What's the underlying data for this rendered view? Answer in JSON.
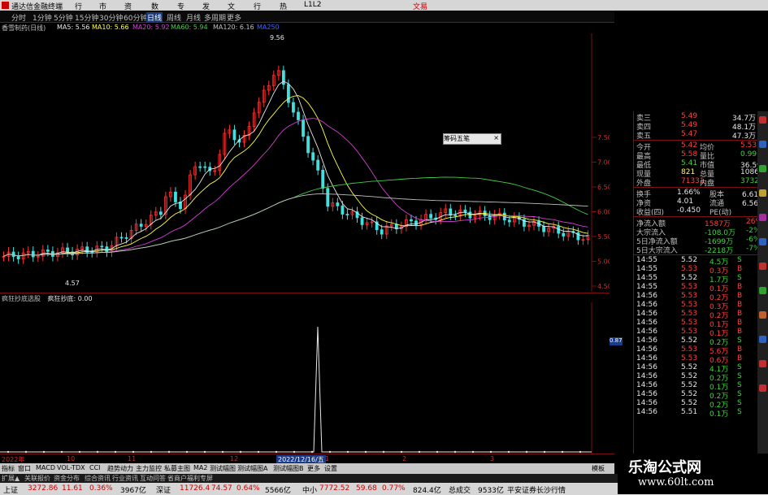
{
  "app": {
    "title": "通达信金融终端",
    "menu": [
      "行情",
      "市场",
      "资讯",
      "数据",
      "专题",
      "发现",
      "文题",
      "行业",
      "热点",
      "L1L2"
    ],
    "trade_label": "文易"
  },
  "toolbar": {
    "items": [
      "分时",
      "1分钟",
      "5分钟",
      "15分钟",
      "30分钟",
      "60分钟",
      "日线",
      "周线",
      "月线",
      "多周期",
      "更多"
    ],
    "active_index": 6
  },
  "legend": {
    "stock": "香雪制药(日线)",
    "ma": [
      {
        "label": "MA5: 5.56",
        "color": "#e8e8e8"
      },
      {
        "label": "MA10: 5.66",
        "color": "#ffff40"
      },
      {
        "label": "MA20: 5.92",
        "color": "#d040d0"
      },
      {
        "label": "MA60: 5.94",
        "color": "#40d040"
      },
      {
        "label": "MA120: 6.16",
        "color": "#c0c0c0"
      },
      {
        "label": "MA250",
        "color": "#4060ff"
      }
    ]
  },
  "main_chart": {
    "y_ticks": [
      "7.50",
      "7.00",
      "6.50",
      "6.00",
      "5.50",
      "5.00",
      "4.50"
    ],
    "high_label": "9.56",
    "low_label": "4.57"
  },
  "indicator": {
    "title": "疯狂抄底选股",
    "value_label": "疯狂抄底: 0.00",
    "y_tick": "0.87"
  },
  "x_axis": {
    "labels": [
      "2022年",
      "10",
      "11",
      "12",
      "1",
      "2",
      "3"
    ],
    "highlight": "2022/12/16/五"
  },
  "tabs": [
    "指标",
    "窗口",
    "MACD",
    "VOL-TDX",
    "CCI",
    "趋势动力",
    "主力监控",
    "私募主图",
    "MA2",
    "测试幅图",
    "测试幅图A",
    "测试幅图B",
    "更多",
    "设置"
  ],
  "tabs_right": "模板",
  "tabs2": [
    "扩展▲",
    "关联报价",
    "资金分布",
    "综合资讯",
    "行业资讯",
    "互动问答",
    "省商户福利专屏"
  ],
  "widget_label": "筹码五笔",
  "quote": {
    "asks": [
      {
        "label": "卖三",
        "price": "5.49",
        "vol": "34.7万"
      },
      {
        "label": "卖四",
        "price": "5.49",
        "vol": "48.1万"
      },
      {
        "label": "卖五",
        "price": "5.47",
        "vol": "47.3万"
      }
    ],
    "fields": [
      {
        "l1": "今开",
        "v1": "5.42",
        "l2": "均价",
        "v2": "5.53"
      },
      {
        "l1": "最高",
        "v1": "5.58",
        "l2": "量比",
        "v2": "0.99"
      },
      {
        "l1": "最低",
        "v1": "5.41",
        "l2": "市值",
        "v2": "36.5亿"
      },
      {
        "l1": "现量",
        "v1": "821",
        "l2": "总量",
        "v2": "108653"
      },
      {
        "l1": "外盘",
        "v1": "71331",
        "l2": "内盘",
        "v2": "37322"
      }
    ],
    "fields2": [
      {
        "l1": "换手",
        "v1": "1.66%",
        "l2": "股本",
        "v2": "6.61亿"
      },
      {
        "l1": "净资",
        "v1": "4.01",
        "l2": "流通",
        "v2": "6.56亿"
      },
      {
        "l1": "收益(四)",
        "v1": "-0.450",
        "l2": "PE(动)",
        "v2": ""
      }
    ],
    "flows": [
      {
        "label": "净流入额",
        "value": "1587万",
        "pct": "26%",
        "color": "#ff4040"
      },
      {
        "label": "大宗流入",
        "value": "-108.0万",
        "pct": "-2%",
        "color": "#3fd43f"
      },
      {
        "label": "5日净流入额",
        "value": "-1699万",
        "pct": "-6%",
        "color": "#3fd43f"
      },
      {
        "label": "5日大宗流入",
        "value": "-2218万",
        "pct": "-7%",
        "color": "#3fd43f"
      }
    ],
    "ticks": [
      {
        "t": "14:55",
        "p": "5.52",
        "v": "4.5万",
        "s": "S"
      },
      {
        "t": "14:55",
        "p": "5.53",
        "v": "0.3万",
        "s": "B"
      },
      {
        "t": "14:55",
        "p": "5.52",
        "v": "1.7万",
        "s": "S"
      },
      {
        "t": "14:55",
        "p": "5.53",
        "v": "0.1万",
        "s": "B"
      },
      {
        "t": "14:56",
        "p": "5.53",
        "v": "0.2万",
        "s": "B"
      },
      {
        "t": "14:56",
        "p": "5.53",
        "v": "0.3万",
        "s": "B"
      },
      {
        "t": "14:56",
        "p": "5.53",
        "v": "0.2万",
        "s": "B"
      },
      {
        "t": "14:56",
        "p": "5.53",
        "v": "0.1万",
        "s": "B"
      },
      {
        "t": "14:56",
        "p": "5.53",
        "v": "0.1万",
        "s": "B"
      },
      {
        "t": "14:56",
        "p": "5.52",
        "v": "0.2万",
        "s": "S"
      },
      {
        "t": "14:56",
        "p": "5.53",
        "v": "5.6万",
        "s": "B"
      },
      {
        "t": "14:56",
        "p": "5.53",
        "v": "0.6万",
        "s": "B"
      },
      {
        "t": "14:56",
        "p": "5.52",
        "v": "4.1万",
        "s": "S"
      },
      {
        "t": "14:56",
        "p": "5.52",
        "v": "0.2万",
        "s": "S"
      },
      {
        "t": "14:56",
        "p": "5.52",
        "v": "0.1万",
        "s": "S"
      },
      {
        "t": "14:56",
        "p": "5.52",
        "v": "0.2万",
        "s": "S"
      },
      {
        "t": "14:56",
        "p": "5.52",
        "v": "0.2万",
        "s": "S"
      },
      {
        "t": "14:56",
        "p": "5.51",
        "v": "0.1万",
        "s": "S"
      }
    ]
  },
  "status": [
    {
      "text": "上证",
      "color": "#000"
    },
    {
      "text": "3272.86",
      "color": "#c00"
    },
    {
      "text": "11.61",
      "color": "#c00"
    },
    {
      "text": "0.36%",
      "color": "#c00"
    },
    {
      "text": "3967亿",
      "color": "#000"
    },
    {
      "text": "深证",
      "color": "#000"
    },
    {
      "text": "11726.4",
      "color": "#c00"
    },
    {
      "text": "74.57",
      "color": "#c00"
    },
    {
      "text": "0.64%",
      "color": "#c00"
    },
    {
      "text": "5566亿",
      "color": "#000"
    },
    {
      "text": "中小",
      "color": "#000"
    },
    {
      "text": "7772.52",
      "color": "#c00"
    },
    {
      "text": "59.68",
      "color": "#c00"
    },
    {
      "text": "0.77%",
      "color": "#c00"
    },
    {
      "text": "824.4亿",
      "color": "#000"
    },
    {
      "text": "总成交",
      "color": "#000"
    },
    {
      "text": "9533亿",
      "color": "#000"
    },
    {
      "text": "平安证券长沙行情",
      "color": "#000"
    }
  ],
  "watermark": {
    "line1": "乐淘公式网",
    "line2": "www.60lt.com"
  }
}
